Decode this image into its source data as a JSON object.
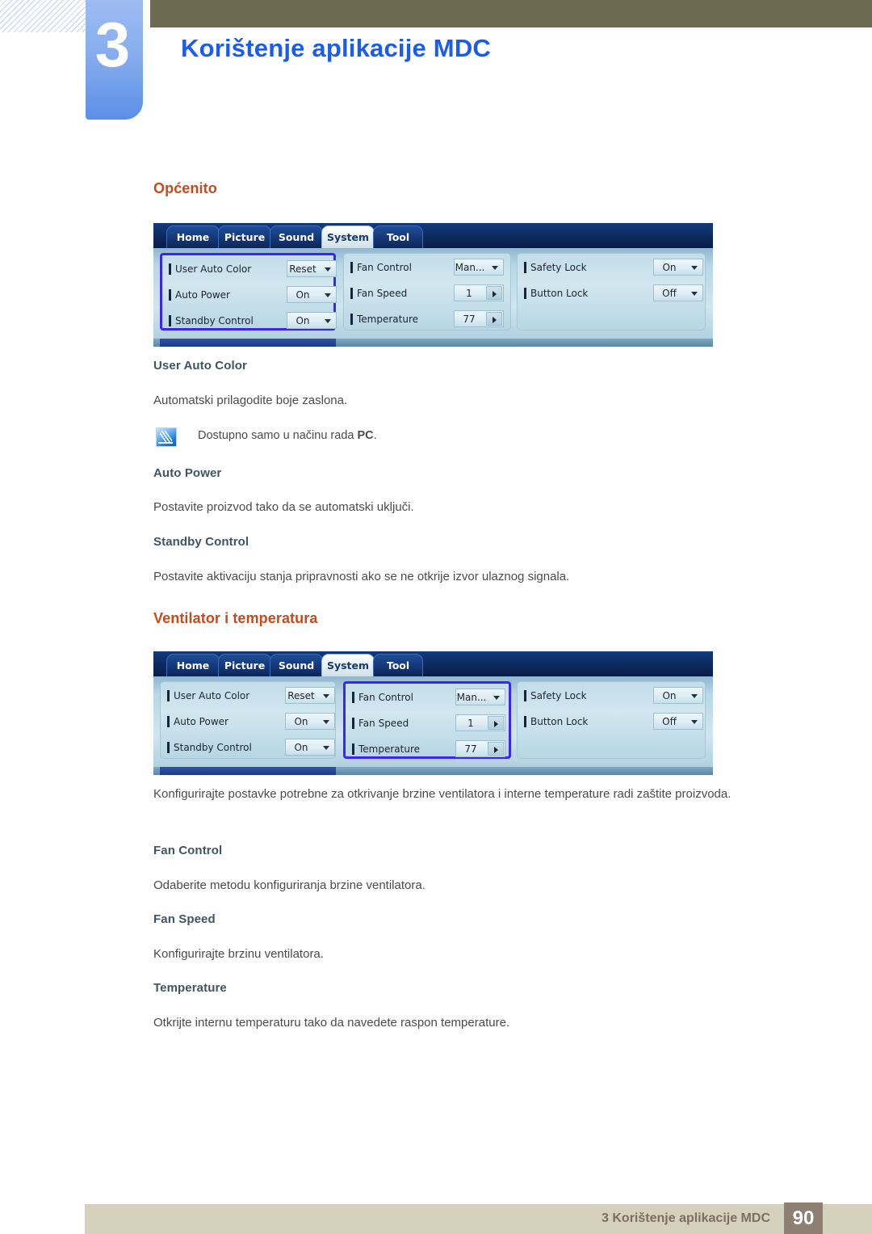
{
  "header": {
    "chapter_number": "3",
    "chapter_title": "Korištenje aplikacije MDC"
  },
  "sections": {
    "general": {
      "heading": "Općenito",
      "subs": [
        {
          "title": "User Auto Color",
          "body": "Automatski prilagodite boje zaslona."
        },
        {
          "title": "Auto Power",
          "body": "Postavite proizvod tako da se automatski uključi."
        },
        {
          "title": "Standby Control",
          "body": "Postavite aktivaciju stanja pripravnosti ako se ne otkrije izvor ulaznog signala."
        }
      ],
      "note": {
        "icon": "note-pen-icon",
        "text_before": "Dostupno samo u načinu rada ",
        "text_bold": "PC",
        "text_after": "."
      }
    },
    "fan": {
      "heading": "Ventilator i temperatura",
      "intro": "Konfigurirajte postavke potrebne za otkrivanje brzine ventilatora i interne temperature radi zaštite proizvoda.",
      "subs": [
        {
          "title": "Fan Control",
          "body": "Odaberite metodu konfiguriranja brzine ventilatora."
        },
        {
          "title": "Fan Speed",
          "body": "Konfigurirajte brzinu ventilatora."
        },
        {
          "title": "Temperature",
          "body": "Otkrijte internu temperaturu tako da navedete raspon temperature."
        }
      ]
    }
  },
  "mdc_panel": {
    "tabs": [
      {
        "label": "Home",
        "active": false
      },
      {
        "label": "Picture",
        "active": false
      },
      {
        "label": "Sound",
        "active": false
      },
      {
        "label": "System",
        "active": true
      },
      {
        "label": "Tool",
        "active": false
      }
    ],
    "columns": [
      {
        "name": "general-column",
        "rows": [
          {
            "label": "User Auto Color",
            "value": "Reset",
            "control": "dropdown"
          },
          {
            "label": "Auto Power",
            "value": "On",
            "control": "dropdown"
          },
          {
            "label": "Standby Control",
            "value": "On",
            "control": "dropdown"
          }
        ]
      },
      {
        "name": "fan-temperature-column",
        "rows": [
          {
            "label": "Fan Control",
            "value": "Man...",
            "control": "dropdown"
          },
          {
            "label": "Fan Speed",
            "value": "1",
            "control": "spinner"
          },
          {
            "label": "Temperature",
            "value": "77",
            "control": "spinner"
          }
        ]
      },
      {
        "name": "lock-column",
        "rows": [
          {
            "label": "Safety Lock",
            "value": "On",
            "control": "dropdown"
          },
          {
            "label": "Button Lock",
            "value": "Off",
            "control": "dropdown"
          }
        ]
      }
    ],
    "highlight_first": 0,
    "highlight_second": 1
  },
  "footer": {
    "text": "3 Korištenje aplikacije MDC",
    "page": "90"
  },
  "colors": {
    "heading_orange": "#c8491c",
    "subheading_slate": "#3f5562",
    "title_blue": "#1b5cf0",
    "header_olive": "#6e6a52",
    "footer_beige": "#d6d1bd",
    "footer_page_brown": "#8d7f72",
    "highlight_blue": "#3a26ef"
  }
}
